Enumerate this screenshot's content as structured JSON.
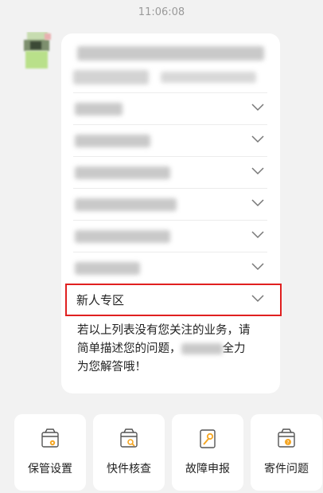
{
  "timestamp": "11:06:08",
  "menu": {
    "items": [
      {
        "label": "",
        "redacted": true
      },
      {
        "label": "",
        "redacted": true
      },
      {
        "label": "",
        "redacted": true
      },
      {
        "label": "",
        "redacted": true
      },
      {
        "label": "",
        "redacted": true
      },
      {
        "label": "",
        "redacted": true
      },
      {
        "label": "新人专区",
        "redacted": false
      }
    ],
    "highlighted_label": "新人专区"
  },
  "outro": {
    "line1": "若以上列表没有您关注的业务，请",
    "line2_prefix": "简单描述您的问题，",
    "line2_suffix": "全力",
    "line3": "为您解答哦！"
  },
  "tiles": [
    {
      "label": "保管设置",
      "icon": "box-gear-icon"
    },
    {
      "label": "快件核查",
      "icon": "box-search-icon"
    },
    {
      "label": "故障申报",
      "icon": "wrench-doc-icon"
    },
    {
      "label": "寄件问题",
      "icon": "box-question-icon"
    }
  ],
  "colors": {
    "highlight": "#e02020",
    "background": "#f2f2f2",
    "card": "#ffffff"
  }
}
